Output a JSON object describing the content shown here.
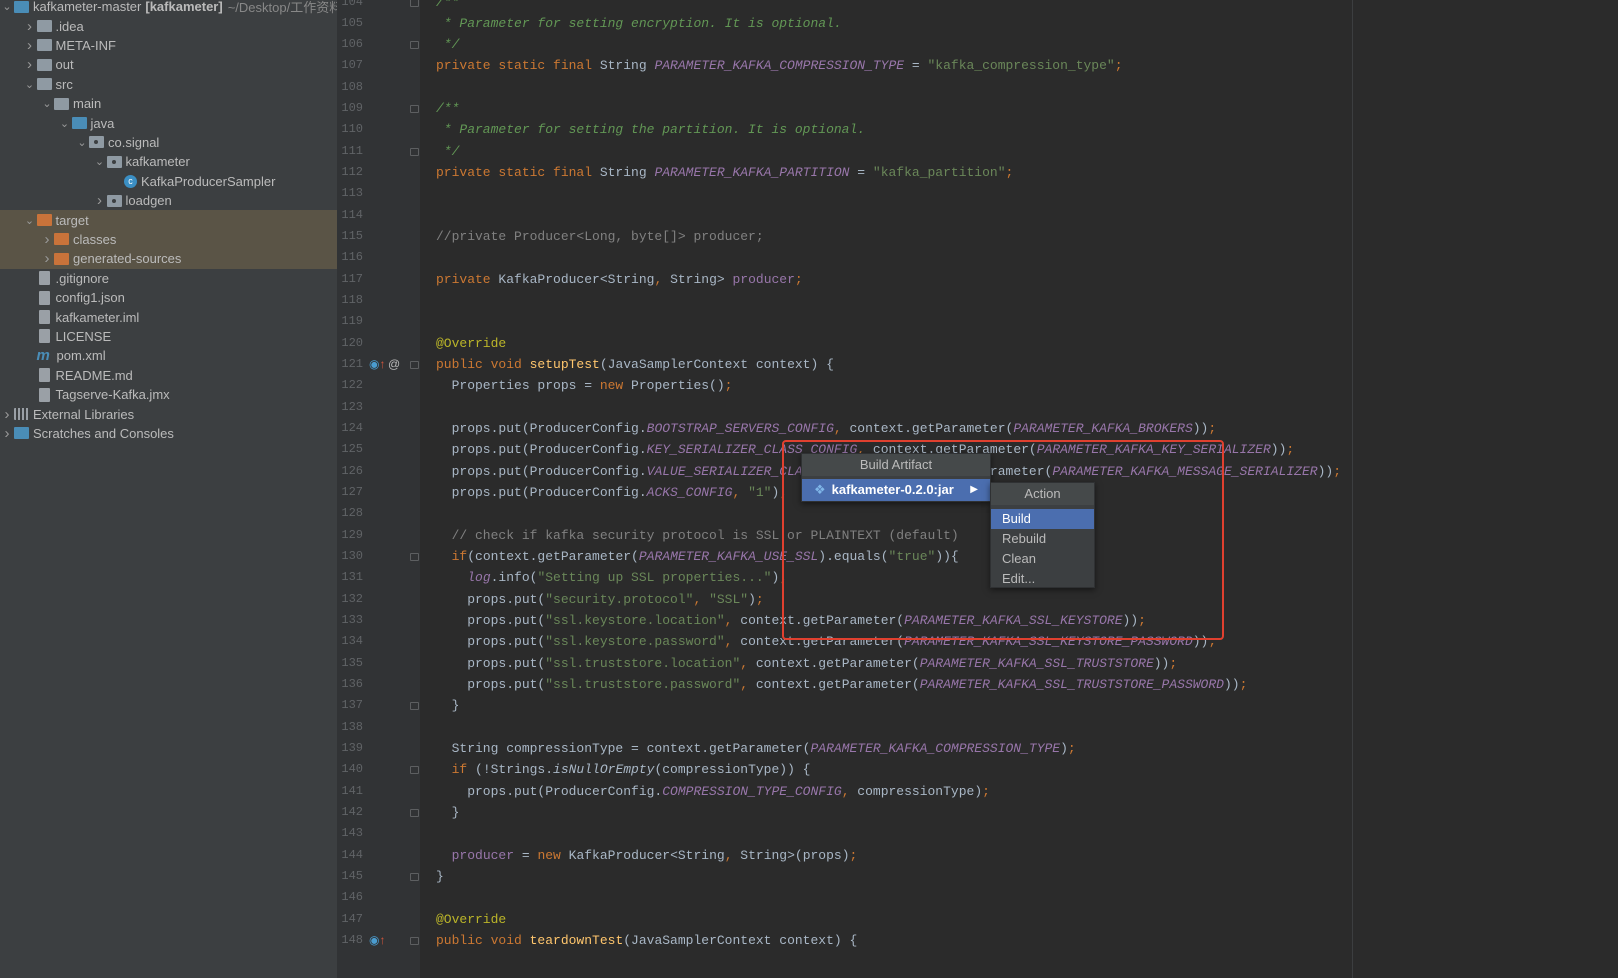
{
  "project_tree": [
    {
      "label": "kafkameter-master",
      "bold": "[kafkameter]",
      "path": "~/Desktop/工作资料",
      "level": 0,
      "arrow": "down",
      "icon": "module-folder-icon"
    },
    {
      "label": ".idea",
      "level": 1,
      "arrow": "right",
      "icon": "folder-icon"
    },
    {
      "label": "META-INF",
      "level": 1,
      "arrow": "right",
      "icon": "folder-icon"
    },
    {
      "label": "out",
      "level": 1,
      "arrow": "right",
      "icon": "folder-icon"
    },
    {
      "label": "src",
      "level": 1,
      "arrow": "down",
      "icon": "folder-icon"
    },
    {
      "label": "main",
      "level": 2,
      "arrow": "down",
      "icon": "folder-icon"
    },
    {
      "label": "java",
      "level": 3,
      "arrow": "down",
      "icon": "source-folder-icon"
    },
    {
      "label": "co.signal",
      "level": 4,
      "arrow": "down",
      "icon": "package-icon"
    },
    {
      "label": "kafkameter",
      "level": 5,
      "arrow": "down",
      "icon": "package-icon"
    },
    {
      "label": "KafkaProducerSampler",
      "level": 6,
      "arrow": "",
      "icon": "class-icon"
    },
    {
      "label": "loadgen",
      "level": 5,
      "arrow": "right",
      "icon": "package-icon"
    },
    {
      "label": "target",
      "level": 1,
      "arrow": "down",
      "icon": "excluded-folder-icon",
      "highlight": true
    },
    {
      "label": "classes",
      "level": 2,
      "arrow": "right",
      "icon": "excluded-folder-icon",
      "highlight": true
    },
    {
      "label": "generated-sources",
      "level": 2,
      "arrow": "right",
      "icon": "excluded-folder-icon",
      "highlight": true
    },
    {
      "label": ".gitignore",
      "level": 1,
      "arrow": "",
      "icon": "file-icon"
    },
    {
      "label": "config1.json",
      "level": 1,
      "arrow": "",
      "icon": "file-icon"
    },
    {
      "label": "kafkameter.iml",
      "level": 1,
      "arrow": "",
      "icon": "file-icon"
    },
    {
      "label": "LICENSE",
      "level": 1,
      "arrow": "",
      "icon": "file-icon"
    },
    {
      "label": "pom.xml",
      "level": 1,
      "arrow": "",
      "icon": "maven-icon"
    },
    {
      "label": "README.md",
      "level": 1,
      "arrow": "",
      "icon": "file-icon"
    },
    {
      "label": "Tagserve-Kafka.jmx",
      "level": 1,
      "arrow": "",
      "icon": "file-icon"
    },
    {
      "label": "External Libraries",
      "level": 0,
      "arrow": "right",
      "icon": "library-icon"
    },
    {
      "label": "Scratches and Consoles",
      "level": 0,
      "arrow": "right",
      "icon": "scratches-icon"
    }
  ],
  "editor": {
    "first_line": 104,
    "fold_lines": [
      104,
      106,
      109,
      111,
      121,
      130,
      137,
      140,
      142,
      145,
      148
    ],
    "override_lines": [
      121,
      148
    ],
    "annotation_lines": [
      121
    ],
    "lines": [
      [
        [
          "doc",
          "/**"
        ]
      ],
      [
        [
          "doc",
          " * Parameter for setting encryption. It is optional."
        ]
      ],
      [
        [
          "doc",
          " */"
        ]
      ],
      [
        [
          "kw",
          "private static final "
        ],
        [
          "",
          "String "
        ],
        [
          "c",
          "PARAMETER_KAFKA_COMPRESSION_TYPE"
        ],
        [
          "",
          " = "
        ],
        [
          "str",
          "\"kafka_compression_type\""
        ],
        [
          "p",
          ";"
        ]
      ],
      [],
      [
        [
          "doc",
          "/**"
        ]
      ],
      [
        [
          "doc",
          " * Parameter for setting the partition. It is optional."
        ]
      ],
      [
        [
          "doc",
          " */"
        ]
      ],
      [
        [
          "kw",
          "private static final "
        ],
        [
          "",
          "String "
        ],
        [
          "c",
          "PARAMETER_KAFKA_PARTITION"
        ],
        [
          "",
          " = "
        ],
        [
          "str",
          "\"kafka_partition\""
        ],
        [
          "p",
          ";"
        ]
      ],
      [],
      [],
      [
        [
          "cm",
          "//private Producer<Long, byte[]> producer;"
        ]
      ],
      [],
      [
        [
          "kw",
          "private "
        ],
        [
          "",
          "KafkaProducer<String"
        ],
        [
          "p",
          ", "
        ],
        [
          "",
          "String> "
        ],
        [
          "f",
          "producer"
        ],
        [
          "p",
          ";"
        ]
      ],
      [],
      [],
      [
        [
          "ann",
          "@Override"
        ]
      ],
      [
        [
          "kw",
          "public void "
        ],
        [
          "fn",
          "setupTest"
        ],
        [
          "",
          "(JavaSamplerContext context) {"
        ]
      ],
      [
        [
          "",
          "  Properties props = "
        ],
        [
          "kw",
          "new "
        ],
        [
          "",
          "Properties()"
        ],
        [
          "p",
          ";"
        ]
      ],
      [],
      [
        [
          "",
          "  props.put(ProducerConfig."
        ],
        [
          "c",
          "BOOTSTRAP_SERVERS_CONFIG"
        ],
        [
          "p",
          ", "
        ],
        [
          "",
          "context.getParameter("
        ],
        [
          "c",
          "PARAMETER_KAFKA_BROKERS"
        ],
        [
          "",
          "))"
        ],
        [
          "p",
          ";"
        ]
      ],
      [
        [
          "",
          "  props.put(ProducerConfig."
        ],
        [
          "c",
          "KEY_SERIALIZER_CLASS_CONFIG"
        ],
        [
          "p",
          ", "
        ],
        [
          "",
          "context.getParameter("
        ],
        [
          "c",
          "PARAMETER_KAFKA_KEY_SERIALIZER"
        ],
        [
          "",
          "))"
        ],
        [
          "p",
          ";"
        ]
      ],
      [
        [
          "",
          "  props.put(ProducerConfig."
        ],
        [
          "c",
          "VALUE_SERIALIZER_CLASS_CONFIG"
        ],
        [
          "p",
          ", "
        ],
        [
          "",
          "context.getParameter("
        ],
        [
          "c",
          "PARAMETER_KAFKA_MESSAGE_SERIALIZER"
        ],
        [
          "",
          "))"
        ],
        [
          "p",
          ";"
        ]
      ],
      [
        [
          "",
          "  props.put(ProducerConfig."
        ],
        [
          "c",
          "ACKS_CONFIG"
        ],
        [
          "p",
          ", "
        ],
        [
          "str",
          "\"1\""
        ],
        [
          "",
          ")"
        ],
        [
          "p",
          ";"
        ]
      ],
      [],
      [
        [
          "cm",
          "  // check if kafka security protocol is SSL or PLAINTEXT (default)"
        ]
      ],
      [
        [
          "kw",
          "  if"
        ],
        [
          "",
          "(context.getParameter("
        ],
        [
          "c",
          "PARAMETER_KAFKA_USE_SSL"
        ],
        [
          "",
          ").equals("
        ],
        [
          "str",
          "\"true\""
        ],
        [
          "",
          ")){"
        ]
      ],
      [
        [
          "",
          "    "
        ],
        [
          "c",
          "log"
        ],
        [
          "",
          ".info("
        ],
        [
          "str",
          "\"Setting up SSL properties...\""
        ],
        [
          "",
          ")"
        ],
        [
          "p",
          ";"
        ]
      ],
      [
        [
          "",
          "    props.put("
        ],
        [
          "str",
          "\"security.protocol\""
        ],
        [
          "p",
          ", "
        ],
        [
          "str",
          "\"SSL\""
        ],
        [
          "",
          ")"
        ],
        [
          "p",
          ";"
        ]
      ],
      [
        [
          "",
          "    props.put("
        ],
        [
          "str",
          "\"ssl.keystore.location\""
        ],
        [
          "p",
          ", "
        ],
        [
          "",
          "context.getParameter("
        ],
        [
          "c",
          "PARAMETER_KAFKA_SSL_KEYSTORE"
        ],
        [
          "",
          "))"
        ],
        [
          "p",
          ";"
        ]
      ],
      [
        [
          "",
          "    props.put("
        ],
        [
          "str",
          "\"ssl.keystore.password\""
        ],
        [
          "p",
          ", "
        ],
        [
          "",
          "context.getParameter("
        ],
        [
          "c",
          "PARAMETER_KAFKA_SSL_KEYSTORE_PASSWORD"
        ],
        [
          "",
          "))"
        ],
        [
          "p",
          ";"
        ]
      ],
      [
        [
          "",
          "    props.put("
        ],
        [
          "str",
          "\"ssl.truststore.location\""
        ],
        [
          "p",
          ", "
        ],
        [
          "",
          "context.getParameter("
        ],
        [
          "c",
          "PARAMETER_KAFKA_SSL_TRUSTSTORE"
        ],
        [
          "",
          "))"
        ],
        [
          "p",
          ";"
        ]
      ],
      [
        [
          "",
          "    props.put("
        ],
        [
          "str",
          "\"ssl.truststore.password\""
        ],
        [
          "p",
          ", "
        ],
        [
          "",
          "context.getParameter("
        ],
        [
          "c",
          "PARAMETER_KAFKA_SSL_TRUSTSTORE_PASSWORD"
        ],
        [
          "",
          "))"
        ],
        [
          "p",
          ";"
        ]
      ],
      [
        [
          "",
          "  }"
        ]
      ],
      [],
      [
        [
          "",
          "  String compressionType = context.getParameter("
        ],
        [
          "c",
          "PARAMETER_KAFKA_COMPRESSION_TYPE"
        ],
        [
          "",
          ")"
        ],
        [
          "p",
          ";"
        ]
      ],
      [
        [
          "kw",
          "  if "
        ],
        [
          "",
          "(!Strings."
        ],
        [
          "it",
          "isNullOrEmpty"
        ],
        [
          "",
          "(compressionType)) {"
        ]
      ],
      [
        [
          "",
          "    props.put(ProducerConfig."
        ],
        [
          "c",
          "COMPRESSION_TYPE_CONFIG"
        ],
        [
          "p",
          ", "
        ],
        [
          "",
          "compressionType)"
        ],
        [
          "p",
          ";"
        ]
      ],
      [
        [
          "",
          "  }"
        ]
      ],
      [],
      [
        [
          "",
          "  "
        ],
        [
          "f",
          "producer"
        ],
        [
          "",
          " = "
        ],
        [
          "kw",
          "new "
        ],
        [
          "",
          "KafkaProducer<String"
        ],
        [
          "p",
          ", "
        ],
        [
          "",
          "String>(props)"
        ],
        [
          "p",
          ";"
        ]
      ],
      [
        [
          "",
          "}"
        ]
      ],
      [],
      [
        [
          "ann",
          "@Override"
        ]
      ],
      [
        [
          "kw",
          "public void "
        ],
        [
          "fn",
          "teardownTest"
        ],
        [
          "",
          "(JavaSamplerContext context) {"
        ]
      ]
    ]
  },
  "build_artifact_menu": {
    "title": "Build Artifact",
    "item": "kafkameter-0.2.0:jar",
    "item_icon": "artifact-icon"
  },
  "action_menu": {
    "title": "Action",
    "items": [
      "Build",
      "Rebuild",
      "Clean",
      "Edit..."
    ],
    "selected": "Build"
  },
  "colors": {
    "selection": "#4b6eaf",
    "highlight_box": "#e0402f",
    "excluded_folder": "#c9733a"
  }
}
